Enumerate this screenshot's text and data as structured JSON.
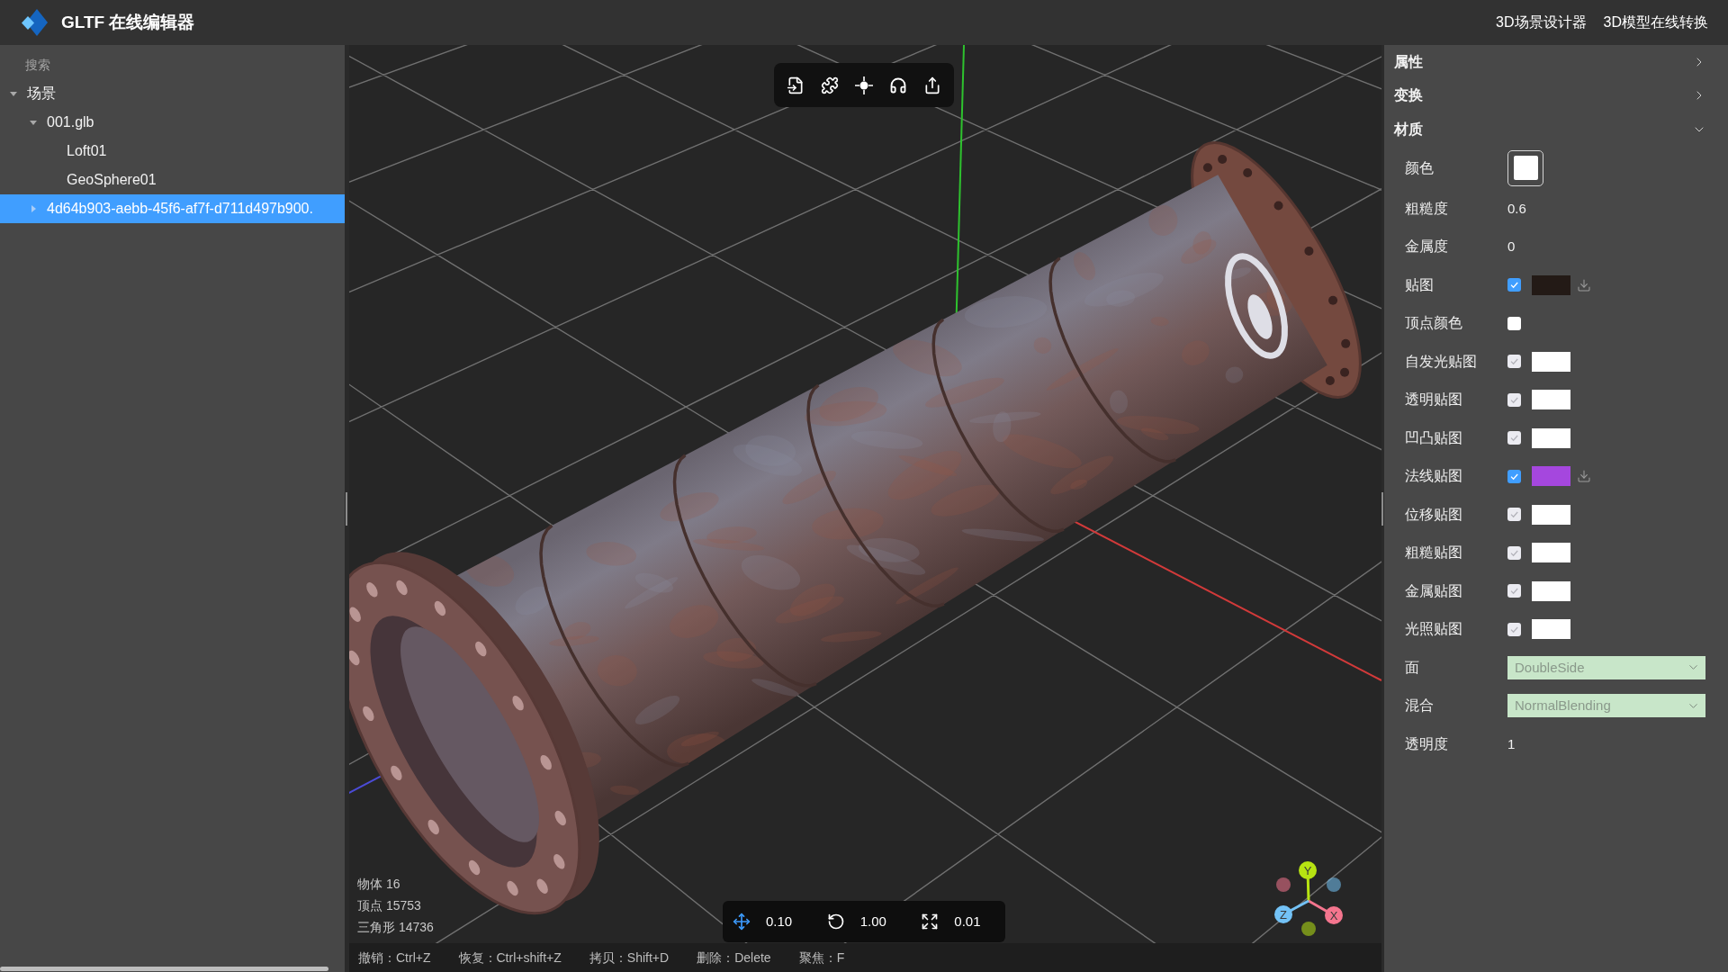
{
  "header": {
    "title": "GLTF 在线编辑器",
    "links": [
      "3D场景设计器",
      "3D模型在线转换"
    ]
  },
  "outliner": {
    "search": {
      "placeholder": "搜索"
    },
    "tree": [
      {
        "label": "场景",
        "expanded": true,
        "selected": false,
        "children": [
          {
            "label": "001.glb",
            "expanded": true,
            "selected": false,
            "children": [
              {
                "label": "Loft01",
                "selected": false
              },
              {
                "label": "GeoSphere01",
                "selected": false
              }
            ]
          },
          {
            "label": "4d64b903-aebb-45f6-af7f-d711d497b900.",
            "expanded": false,
            "selected": true
          }
        ]
      }
    ]
  },
  "viewport": {
    "stats": [
      "物体 16",
      "顶点 15753",
      "三角形 14736"
    ],
    "snap": [
      {
        "kind": "move",
        "value": "0.10",
        "selected": true
      },
      {
        "kind": "rotate",
        "value": "1.00",
        "selected": false
      },
      {
        "kind": "scale",
        "value": "0.01",
        "selected": false
      }
    ],
    "gizmo": {
      "axes": [
        {
          "kind": "y",
          "label": "Y",
          "color": "#b7e312"
        },
        {
          "kind": "x",
          "label": "X",
          "color": "#f4758e"
        },
        {
          "kind": "z",
          "label": "Z",
          "color": "#73c2f6"
        }
      ]
    }
  },
  "status_bar": {
    "shortcuts": [
      "撤销：Ctrl+Z",
      "恢复：Ctrl+shift+Z",
      "拷贝：Shift+D",
      "删除：Delete",
      "聚焦：F"
    ]
  },
  "inspector": {
    "sections": [
      {
        "title": "属性",
        "expanded": false
      },
      {
        "title": "变换",
        "expanded": false
      },
      {
        "title": "材质",
        "expanded": true,
        "rows": [
          {
            "kind": "color",
            "label": "颜色",
            "color": "#ffffff"
          },
          {
            "kind": "value",
            "label": "粗糙度",
            "value": "0.6"
          },
          {
            "kind": "value",
            "label": "金属度",
            "value": "0"
          },
          {
            "kind": "texture_map",
            "label": "贴图",
            "checked": true,
            "disabled": false,
            "downloadable": true
          },
          {
            "kind": "checkbox",
            "label": "顶点颜色",
            "checked": false
          },
          {
            "kind": "map",
            "label": "自发光贴图",
            "checked": true,
            "disabled": true,
            "color": "#ffffff",
            "downloadable": false
          },
          {
            "kind": "map",
            "label": "透明贴图",
            "checked": true,
            "disabled": true,
            "color": "#ffffff",
            "downloadable": false
          },
          {
            "kind": "map",
            "label": "凹凸贴图",
            "checked": true,
            "disabled": true,
            "color": "#ffffff",
            "downloadable": false
          },
          {
            "kind": "map",
            "label": "法线贴图",
            "checked": true,
            "disabled": false,
            "color": "#a547de",
            "downloadable": true
          },
          {
            "kind": "map",
            "label": "位移贴图",
            "checked": true,
            "disabled": true,
            "color": "#ffffff",
            "downloadable": false
          },
          {
            "kind": "map",
            "label": "粗糙贴图",
            "checked": true,
            "disabled": true,
            "color": "#ffffff",
            "downloadable": false
          },
          {
            "kind": "map",
            "label": "金属贴图",
            "checked": true,
            "disabled": true,
            "color": "#ffffff",
            "downloadable": false
          },
          {
            "kind": "map",
            "label": "光照贴图",
            "checked": true,
            "disabled": true,
            "color": "#ffffff",
            "downloadable": false
          },
          {
            "kind": "select",
            "label": "面",
            "value": "DoubleSide"
          },
          {
            "kind": "select",
            "label": "混合",
            "value": "NormalBlending"
          },
          {
            "kind": "value",
            "label": "透明度",
            "value": "1"
          }
        ]
      }
    ]
  }
}
